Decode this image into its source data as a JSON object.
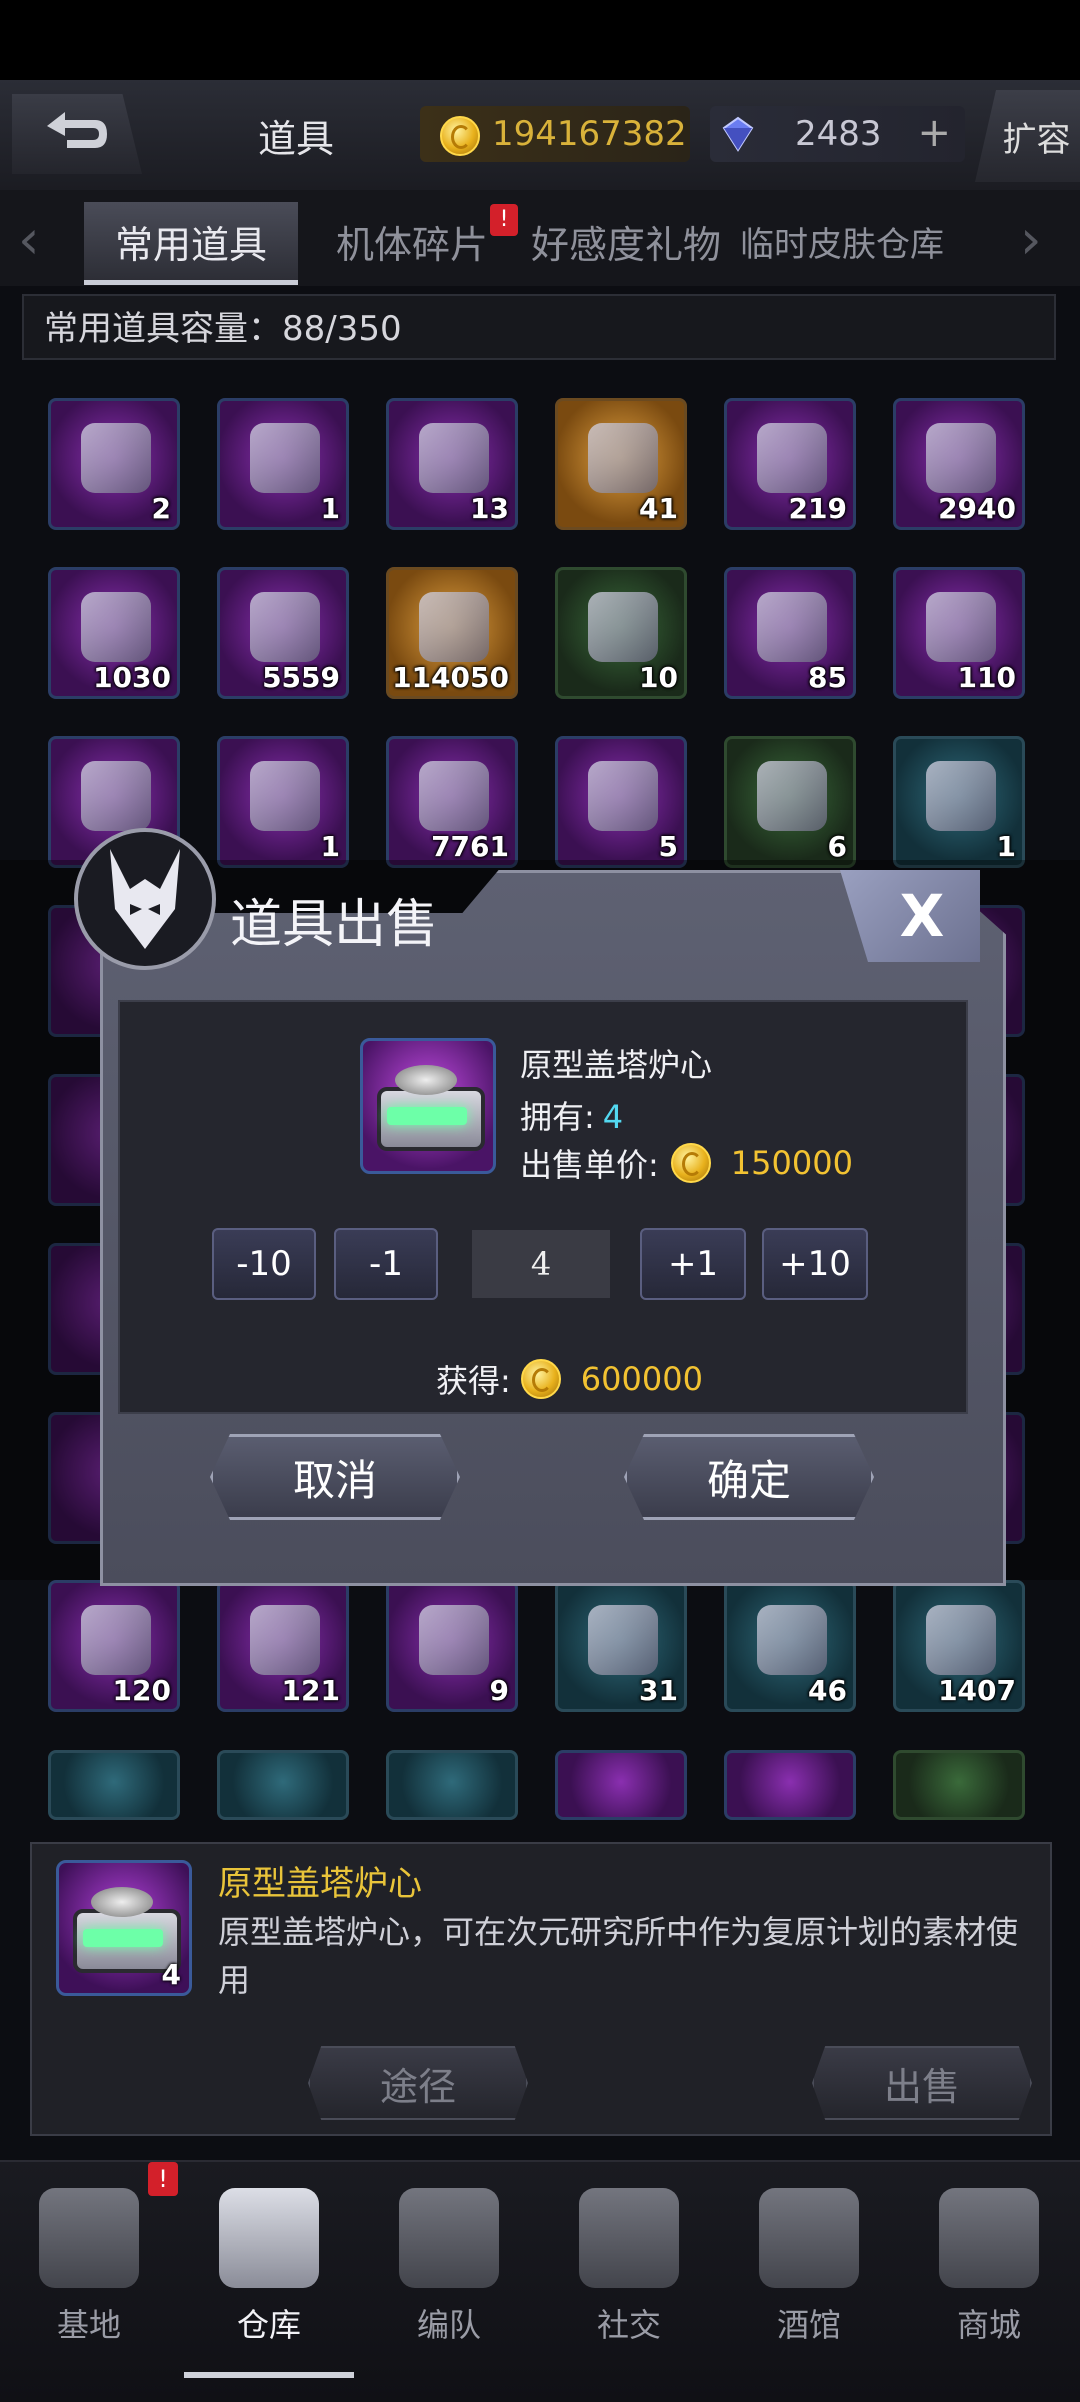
{
  "header": {
    "title": "道具",
    "gold": "194167382",
    "gems": "2483",
    "gem_plus": "+",
    "expand_label": "扩容"
  },
  "tabs": [
    {
      "label": "常用道具",
      "active": true
    },
    {
      "label": "机体碎片",
      "badge": "!"
    },
    {
      "label": "好感度礼物"
    },
    {
      "label": "临时皮肤仓库"
    }
  ],
  "capacity": "常用道具容量：88/350",
  "items": [
    {
      "count": "2"
    },
    {
      "count": "1"
    },
    {
      "count": "13"
    },
    {
      "count": "41"
    },
    {
      "count": "219"
    },
    {
      "count": "2940"
    },
    {
      "count": "1030"
    },
    {
      "count": "5559"
    },
    {
      "count": "114050"
    },
    {
      "count": "10"
    },
    {
      "count": "85"
    },
    {
      "count": "110"
    },
    {
      "count": ""
    },
    {
      "count": "1"
    },
    {
      "count": "7761"
    },
    {
      "count": "5"
    },
    {
      "count": "6"
    },
    {
      "count": "1"
    },
    {
      "count": "120"
    },
    {
      "count": "121"
    },
    {
      "count": "9"
    },
    {
      "count": "31"
    },
    {
      "count": "46"
    },
    {
      "count": "1407"
    }
  ],
  "dialog": {
    "title": "道具出售",
    "close_label": "X",
    "item_name": "原型盖塔炉心",
    "own_label": "拥有:",
    "own_value": "4",
    "price_label": "出售单价:",
    "price_value": "150000",
    "minus10": "-10",
    "minus1": "-1",
    "quantity": "4",
    "plus1": "+1",
    "plus10": "+10",
    "gain_label": "获得:",
    "gain_value": "600000",
    "cancel_label": "取消",
    "confirm_label": "确定"
  },
  "detail": {
    "name": "原型盖塔炉心",
    "count": "4",
    "description": "原型盖塔炉心，可在次元研究所中作为复原计划的素材使用",
    "source_label": "途径",
    "sell_label": "出售"
  },
  "nav": {
    "badge": "!",
    "items": [
      {
        "label": "基地"
      },
      {
        "label": "仓库"
      },
      {
        "label": "编队"
      },
      {
        "label": "社交"
      },
      {
        "label": "酒馆"
      },
      {
        "label": "商城"
      }
    ]
  }
}
